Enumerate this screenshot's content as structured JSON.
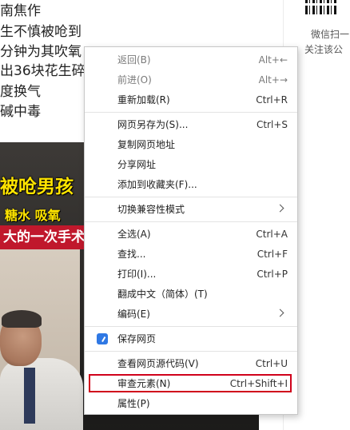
{
  "article": {
    "lines": [
      "南焦作",
      "生不慎被呛到",
      "分钟为其吹氧",
      "出36块花生碎",
      "度换气",
      "碱中毒"
    ]
  },
  "sidebar": {
    "caption1": "微信扫一",
    "caption2": "关注该公"
  },
  "video": {
    "banner1": "被呛男孩",
    "banner2_a": "糖水 ",
    "banner2_b": "吸氧",
    "banner3": "大的一次手术"
  },
  "context_menu": {
    "items": [
      {
        "label": "返回(B)",
        "shortcut": "Alt+←",
        "disabled": true
      },
      {
        "label": "前进(O)",
        "shortcut": "Alt+→",
        "disabled": true
      },
      {
        "label": "重新加载(R)",
        "shortcut": "Ctrl+R"
      },
      {
        "label": "网页另存为(S)...",
        "shortcut": "Ctrl+S"
      },
      {
        "label": "复制网页地址",
        "shortcut": ""
      },
      {
        "label": "分享网址",
        "shortcut": ""
      },
      {
        "label": "添加到收藏夹(F)...",
        "shortcut": ""
      },
      {
        "label": "切换兼容性模式",
        "shortcut": "",
        "submenu": true
      },
      {
        "label": "全选(A)",
        "shortcut": "Ctrl+A"
      },
      {
        "label": "查找...",
        "shortcut": "Ctrl+F"
      },
      {
        "label": "打印(I)...",
        "shortcut": "Ctrl+P"
      },
      {
        "label": "翻成中文（简体）(T)",
        "shortcut": ""
      },
      {
        "label": "编码(E)",
        "shortcut": "",
        "submenu": true
      },
      {
        "label": "保存网页",
        "shortcut": "",
        "icon": "save-page-icon"
      },
      {
        "label": "查看网页源代码(V)",
        "shortcut": "Ctrl+U"
      },
      {
        "label": "审查元素(N)",
        "shortcut": "Ctrl+Shift+I",
        "highlighted": true
      },
      {
        "label": "属性(P)",
        "shortcut": ""
      }
    ]
  },
  "colors": {
    "highlight_border": "#d0021b",
    "save_icon": "#2f78e4"
  }
}
